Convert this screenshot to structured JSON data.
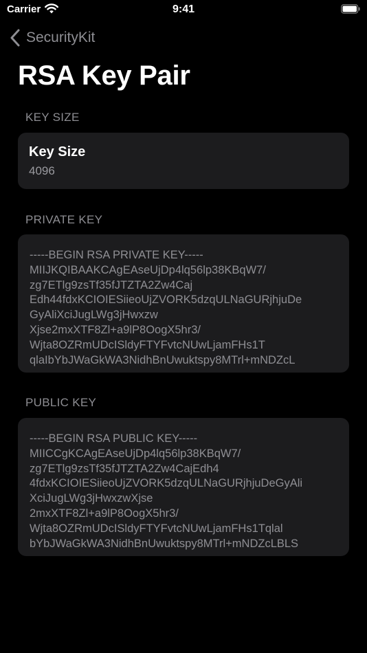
{
  "status_bar": {
    "carrier": "Carrier",
    "time": "9:41"
  },
  "nav": {
    "back_label": "SecurityKit"
  },
  "title": "RSA Key Pair",
  "sections": {
    "key_size": {
      "header": "KEY SIZE",
      "row_title": "Key Size",
      "row_value": "4096"
    },
    "private_key": {
      "header": "PRIVATE KEY",
      "text": "-----BEGIN RSA PRIVATE KEY-----\nMIIJKQIBAAKCAgEAseUjDp4lq56lp38KBqW7/\nzg7ETlg9zsTf35fJTZTA2Zw4Caj\nEdh44fdxKCIOIESiieoUjZVORK5dzqULNaGURjhjuDe\nGyAliXciJugLWg3jHwxzw\nXjse2mxXTF8Zl+a9lP8OogX5hr3/\nWjta8OZRmUDcISldyFTYFvtcNUwLjamFHs1T\nqlaIbYbJWaGkWA3NidhBnUwuktspy8MTrl+mNDZcL"
    },
    "public_key": {
      "header": "PUBLIC KEY",
      "text": "-----BEGIN RSA PUBLIC KEY-----\nMIICCgKCAgEAseUjDp4lq56lp38KBqW7/\nzg7ETlg9zsTf35fJTZTA2Zw4CajEdh4\n4fdxKCIOIESiieoUjZVORK5dzqULNaGURjhjuDeGyAli\nXciJugLWg3jHwxzwXjse\n2mxXTF8Zl+a9lP8OogX5hr3/\nWjta8OZRmUDcISldyFTYFvtcNUwLjamFHs1Tqlal\nbYbJWaGkWA3NidhBnUwuktspy8MTrl+mNDZcLBLS"
    }
  },
  "icons": {
    "back": "chevron-left-icon",
    "wifi": "wifi-icon",
    "battery": "battery-icon"
  }
}
